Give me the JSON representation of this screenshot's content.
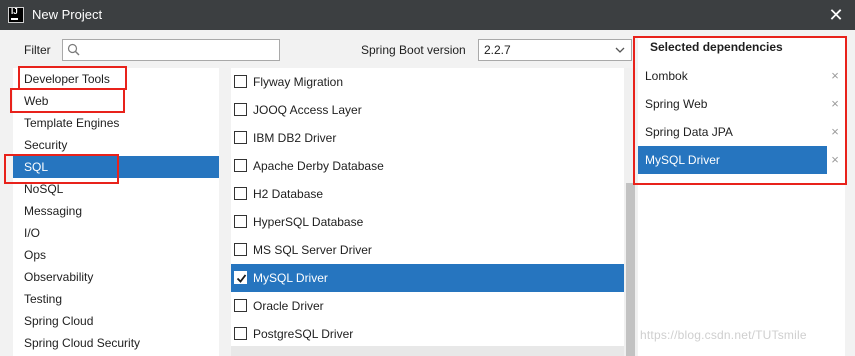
{
  "window": {
    "title": "New Project",
    "app_icon_text": "IJ"
  },
  "filter": {
    "label": "Filter",
    "value": "",
    "placeholder": ""
  },
  "spring_boot": {
    "label": "Spring Boot version",
    "selected": "2.2.7"
  },
  "categories": [
    {
      "label": "Developer Tools"
    },
    {
      "label": "Web"
    },
    {
      "label": "Template Engines"
    },
    {
      "label": "Security"
    },
    {
      "label": "SQL",
      "selected": true
    },
    {
      "label": "NoSQL"
    },
    {
      "label": "Messaging"
    },
    {
      "label": "I/O"
    },
    {
      "label": "Ops"
    },
    {
      "label": "Observability"
    },
    {
      "label": "Testing"
    },
    {
      "label": "Spring Cloud"
    },
    {
      "label": "Spring Cloud Security"
    }
  ],
  "dependencies": [
    {
      "label": "Flyway Migration",
      "checked": false
    },
    {
      "label": "JOOQ Access Layer",
      "checked": false
    },
    {
      "label": "IBM DB2 Driver",
      "checked": false
    },
    {
      "label": "Apache Derby Database",
      "checked": false
    },
    {
      "label": "H2 Database",
      "checked": false
    },
    {
      "label": "HyperSQL Database",
      "checked": false
    },
    {
      "label": "MS SQL Server Driver",
      "checked": false
    },
    {
      "label": "MySQL Driver",
      "checked": true,
      "selected": true
    },
    {
      "label": "Oracle Driver",
      "checked": false
    },
    {
      "label": "PostgreSQL Driver",
      "checked": false
    }
  ],
  "selected_dependencies": {
    "title": "Selected dependencies",
    "items": [
      {
        "label": "Lombok"
      },
      {
        "label": "Spring Web"
      },
      {
        "label": "Spring Data JPA"
      },
      {
        "label": "MySQL Driver",
        "selected": true
      }
    ],
    "remove_glyph": "×"
  },
  "watermark": "https://blog.csdn.net/TUTsmile",
  "colors": {
    "accent": "#2675bf",
    "highlight": "#e8221b",
    "titlebar": "#3c3f41"
  },
  "icons": {
    "close": "close-icon",
    "search": "search-icon",
    "dropdown": "chevron-down-icon",
    "check": "checkmark-icon",
    "remove": "remove-icon"
  }
}
